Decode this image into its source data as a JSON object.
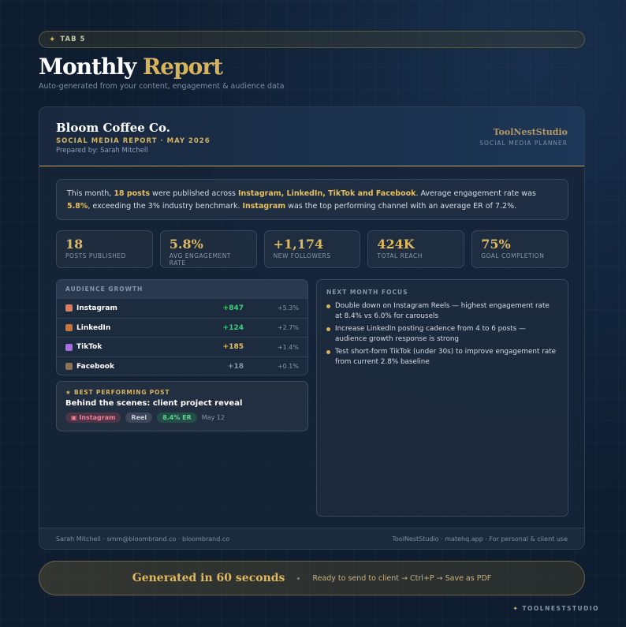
{
  "tab": {
    "label": "TAB 5"
  },
  "header": {
    "title_part1": "Monthly",
    "title_part2": "Report",
    "subtitle": "Auto-generated from your content, engagement & audience data"
  },
  "report": {
    "client": "Bloom Coffee Co.",
    "report_line": "SOCIAL MEDIA REPORT · MAY 2026",
    "prepared_by": "Prepared by: Sarah Mitchell",
    "studio_name": "ToolNestStudio",
    "studio_tag": "SOCIAL MEDIA PLANNER"
  },
  "summary": {
    "t1": "This month, ",
    "b1": "18 posts",
    "t2": " were published across ",
    "b2": "Instagram, LinkedIn, TikTok and Facebook",
    "t3": ". Average engagement rate was ",
    "b3": "5.8%",
    "t4": ", exceeding the 3% industry benchmark. ",
    "b4": "Instagram",
    "t5": " was the top performing channel with an average ER of 7.2%."
  },
  "stats": [
    {
      "value": "18",
      "label": "POSTS PUBLISHED"
    },
    {
      "value": "5.8%",
      "label": "AVG ENGAGEMENT RATE"
    },
    {
      "value": "+1,174",
      "label": "NEW FOLLOWERS"
    },
    {
      "value": "424K",
      "label": "TOTAL REACH"
    },
    {
      "value": "75%",
      "label": "GOAL COMPLETION"
    }
  ],
  "growth": {
    "heading": "AUDIENCE GROWTH",
    "rows": [
      {
        "platform": "Instagram",
        "value": "+847",
        "pct": "+5.3%",
        "color": "#3ecf7a",
        "icon_color": "#e07a5f"
      },
      {
        "platform": "LinkedIn",
        "value": "+124",
        "pct": "+2.7%",
        "color": "#3ecf7a",
        "icon_color": "#c8733a"
      },
      {
        "platform": "TikTok",
        "value": "+185",
        "pct": "+1.4%",
        "color": "#e8bf5e",
        "icon_color": "#a66ee0"
      },
      {
        "platform": "Facebook",
        "value": "+18",
        "pct": "+0.1%",
        "color": "#8896a8",
        "icon_color": "#8a7355"
      }
    ]
  },
  "best_post": {
    "tag": "BEST PERFORMING POST",
    "title": "Behind the scenes: client project reveal",
    "platform": "Instagram",
    "format": "Reel",
    "er": "8.4% ER",
    "date": "May 12"
  },
  "focus": {
    "heading": "NEXT MONTH FOCUS",
    "items": [
      "Double down on Instagram Reels — highest engagement rate at 8.4% vs 6.0% for carousels",
      "Increase LinkedIn posting cadence from 4 to 6 posts — audience growth response is strong",
      "Test short-form TikTok (under 30s) to improve engagement rate from current 2.8% baseline"
    ]
  },
  "footer": {
    "left": "Sarah Mitchell · smm@bloombrand.co · bloombrand.co",
    "right": "ToolNestStudio · matehq.app · For personal & client use"
  },
  "cta": {
    "title": "Generated in 60 seconds",
    "subtitle": "Ready to send to client → Ctrl+P → Save as PDF"
  },
  "corner": {
    "label": "TOOLNESTSTUDIO"
  },
  "colors": {
    "accent": "#d8b35c",
    "background": "#0f1d30"
  }
}
